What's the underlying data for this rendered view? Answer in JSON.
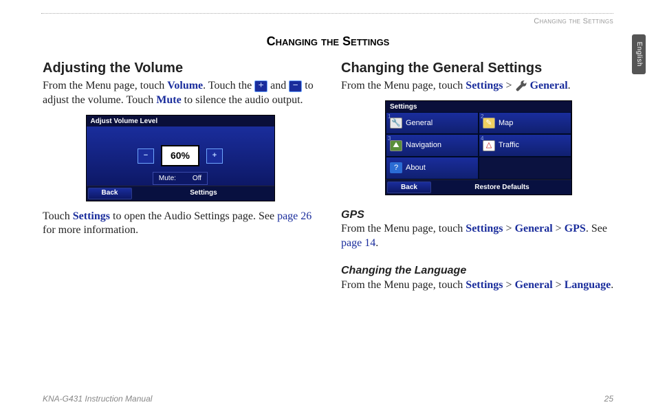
{
  "running_head": "Changing the Settings",
  "side_tab": "English",
  "page_title": "Changing the Settings",
  "left": {
    "heading": "Adjusting the Volume",
    "p1_a": "From the Menu page, touch ",
    "p1_volume": "Volume",
    "p1_b": ". Touch the ",
    "p1_c": " and ",
    "p1_d": " to adjust the volume. Touch ",
    "p1_mute": "Mute",
    "p1_e": " to silence the audio output.",
    "p2_a": "Touch ",
    "p2_settings": "Settings",
    "p2_b": " to open the Audio Settings page. See ",
    "p2_page": "page 26",
    "p2_c": " for more information.",
    "device": {
      "title": "Adjust Volume Level",
      "minus": "−",
      "plus": "+",
      "percent": "60%",
      "mute_label": "Mute:",
      "mute_value": "Off",
      "back": "Back",
      "settings": "Settings"
    }
  },
  "right": {
    "heading": "Changing the General Settings",
    "p1_a": "From the Menu page, touch ",
    "p1_settings": "Settings",
    "p1_b": " > ",
    "p1_general": "General",
    "p1_c": ".",
    "device": {
      "title": "Settings",
      "cells": {
        "general": "General",
        "map": "Map",
        "navigation": "Navigation",
        "traffic": "Traffic",
        "about": "About"
      },
      "nums": {
        "n1": "1",
        "n2": "2",
        "n3": "3",
        "n4": "4"
      },
      "back": "Back",
      "restore": "Restore Defaults"
    },
    "gps": {
      "heading": "GPS",
      "a": "From the Menu page, touch ",
      "settings": "Settings",
      "gt1": " > ",
      "general": "General",
      "gt2": " > ",
      "gps": "GPS",
      "b": ". See ",
      "page": "page 14",
      "c": "."
    },
    "lang": {
      "heading": "Changing the Language",
      "a": "From the Menu page, touch ",
      "settings": "Settings",
      "gt1": " > ",
      "general": "General",
      "gt2": " > ",
      "language": "Language",
      "c": "."
    }
  },
  "footer": {
    "left": "KNA-G431 Instruction Manual",
    "right": "25"
  }
}
